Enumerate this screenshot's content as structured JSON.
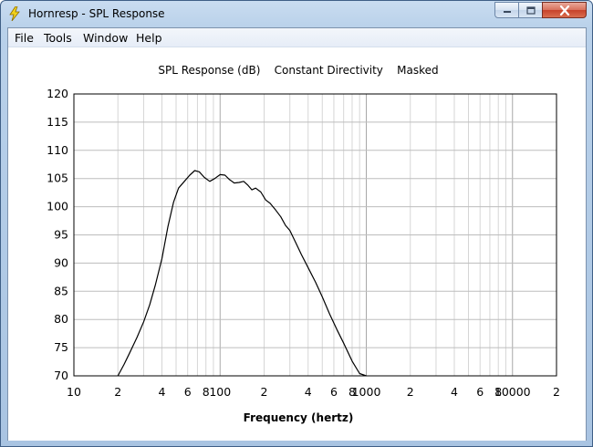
{
  "window": {
    "title": "Hornresp - SPL Response",
    "icon": "lightning-bolt-icon"
  },
  "caption_buttons": {
    "minimize": "minimize-icon",
    "maximize": "maximize-icon",
    "close": "close-icon"
  },
  "menu": {
    "items": [
      "File",
      "Tools",
      "Window",
      "Help"
    ]
  },
  "chart_data": {
    "type": "line",
    "title": "SPL Response (dB)    Constant Directivity    Masked",
    "xlabel": "Frequency (hertz)",
    "ylabel": "",
    "xscale": "log",
    "xlim": [
      10,
      20000
    ],
    "ylim": [
      70,
      120
    ],
    "grid": true,
    "x_tick_labels": [
      "10",
      "2",
      "4",
      "6",
      "8",
      "100",
      "2",
      "4",
      "6",
      "8",
      "1000",
      "2",
      "4",
      "6",
      "8",
      "10000",
      "2"
    ],
    "y_tick_labels": [
      "120",
      "115",
      "110",
      "105",
      "100",
      "95",
      "90",
      "85",
      "80",
      "75",
      "70"
    ],
    "series": [
      {
        "color": "#000000",
        "x": [
          20,
          22,
          24,
          27,
          30,
          33,
          36,
          40,
          44,
          48,
          52,
          57,
          62,
          67,
          72,
          78,
          85,
          92,
          100,
          108,
          116,
          125,
          135,
          145,
          155,
          165,
          175,
          190,
          205,
          220,
          240,
          260,
          280,
          300,
          330,
          360,
          400,
          450,
          500,
          560,
          630,
          700,
          800,
          900,
          1000
        ],
        "y": [
          70,
          72,
          74,
          76.8,
          79.6,
          82.6,
          86,
          90.8,
          96.5,
          100.8,
          103.3,
          104.5,
          105.6,
          106.4,
          106.2,
          105.2,
          104.5,
          105,
          105.7,
          105.6,
          104.8,
          104.2,
          104.3,
          104.5,
          103.8,
          103,
          103.3,
          102.6,
          101.2,
          100.6,
          99.4,
          98.2,
          96.7,
          95.8,
          93.6,
          91.5,
          89.2,
          86.6,
          84,
          81,
          78.2,
          75.8,
          72.6,
          70.4,
          70
        ]
      }
    ]
  }
}
